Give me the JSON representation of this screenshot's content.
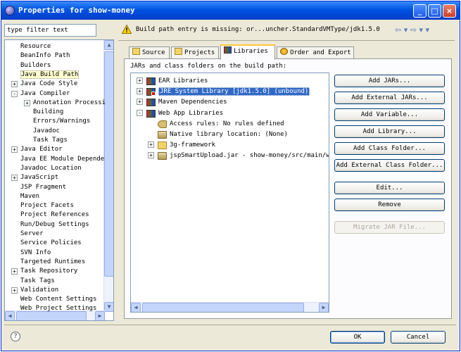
{
  "window": {
    "title": "Properties for show-money",
    "min_label": "_",
    "max_label": "□",
    "close_label": "×"
  },
  "filter": {
    "value": "type filter text"
  },
  "tree": {
    "items": [
      {
        "label": "Resource",
        "expander": ""
      },
      {
        "label": "BeanInfo Path",
        "expander": ""
      },
      {
        "label": "Builders",
        "expander": ""
      },
      {
        "label": "Java Build Path",
        "expander": "",
        "selected": true
      },
      {
        "label": "Java Code Style",
        "expander": "+"
      },
      {
        "label": "Java Compiler",
        "expander": "-"
      },
      {
        "label": "Annotation Processi",
        "expander": "+"
      },
      {
        "label": "Building",
        "expander": ""
      },
      {
        "label": "Errors/Warnings",
        "expander": ""
      },
      {
        "label": "Javadoc",
        "expander": ""
      },
      {
        "label": "Task Tags",
        "expander": ""
      },
      {
        "label": "Java Editor",
        "expander": "+"
      },
      {
        "label": "Java EE Module Depende",
        "expander": ""
      },
      {
        "label": "Javadoc Location",
        "expander": ""
      },
      {
        "label": "JavaScript",
        "expander": "+"
      },
      {
        "label": "JSP Fragment",
        "expander": ""
      },
      {
        "label": "Maven",
        "expander": ""
      },
      {
        "label": "Project Facets",
        "expander": ""
      },
      {
        "label": "Project References",
        "expander": ""
      },
      {
        "label": "Run/Debug Settings",
        "expander": ""
      },
      {
        "label": "Server",
        "expander": ""
      },
      {
        "label": "Service Policies",
        "expander": ""
      },
      {
        "label": "SVN Info",
        "expander": ""
      },
      {
        "label": "Targeted Runtimes",
        "expander": ""
      },
      {
        "label": "Task Repository",
        "expander": "+"
      },
      {
        "label": "Task Tags",
        "expander": ""
      },
      {
        "label": "Validation",
        "expander": "+"
      },
      {
        "label": "Web Content Settings",
        "expander": ""
      },
      {
        "label": "Web Project Settings",
        "expander": ""
      }
    ]
  },
  "header": {
    "message": "Build path entry is missing: or...uncher.StandardVMType/jdk1.5.0",
    "nav": "⇦ ▾ ⇨ ▾ ▾"
  },
  "tabs": [
    {
      "label": "Source",
      "active": false
    },
    {
      "label": "Projects",
      "active": false
    },
    {
      "label": "Libraries",
      "active": true
    },
    {
      "label": "Order and Export",
      "active": false
    }
  ],
  "panel": {
    "label": "JARs and class folders on the build path:",
    "libraries": [
      {
        "label": "EAR Libraries",
        "icon": "books",
        "expander": "+"
      },
      {
        "label": "JRE System Library [jdk1.5.0] (unbound)",
        "icon": "books-error",
        "expander": "+",
        "selected": true
      },
      {
        "label": "Maven Dependencies",
        "icon": "books",
        "expander": "+"
      },
      {
        "label": "Web App Libraries",
        "icon": "books",
        "expander": "-"
      },
      {
        "label": "Access rules: No rules defined",
        "icon": "key",
        "expander": ""
      },
      {
        "label": "Native library location: (None)",
        "icon": "jar",
        "expander": ""
      },
      {
        "label": "3g-framework",
        "icon": "folder",
        "expander": "+"
      },
      {
        "label": "jspSmartUpload.jar - show-money/src/main/we",
        "icon": "jar",
        "expander": "+"
      }
    ],
    "buttons": [
      {
        "label": "Add JARs...",
        "disabled": false
      },
      {
        "label": "Add External JARs...",
        "disabled": false
      },
      {
        "label": "Add Variable...",
        "disabled": false
      },
      {
        "label": "Add Library...",
        "disabled": false
      },
      {
        "label": "Add Class Folder...",
        "disabled": false
      },
      {
        "label": "Add External Class Folder...",
        "disabled": false
      },
      {
        "label": "Edit...",
        "disabled": false
      },
      {
        "label": "Remove",
        "disabled": false
      },
      {
        "label": "Migrate JAR File...",
        "disabled": true
      }
    ]
  },
  "footer": {
    "help": "?",
    "ok": "OK",
    "cancel": "Cancel"
  },
  "colors": {
    "titlebar": "#0054e3",
    "selection": "#316ac5",
    "tab_accent": "#ffc83c"
  }
}
